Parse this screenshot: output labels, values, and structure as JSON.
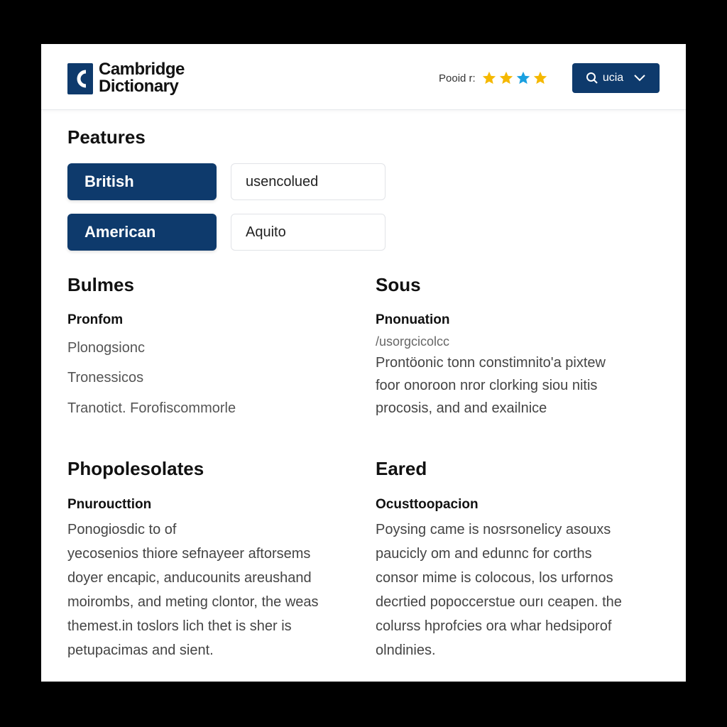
{
  "header": {
    "logo_line1": "Cambridge",
    "logo_line2": "Dictionary",
    "rating_label": "Pooid r:",
    "stars": [
      {
        "icon": "star-icon",
        "color": "#f5b800"
      },
      {
        "icon": "star-icon",
        "color": "#f5b800"
      },
      {
        "icon": "star-icon",
        "color": "#1aa0e0"
      },
      {
        "icon": "star-icon",
        "color": "#f5b800"
      }
    ],
    "search_label": "ucia",
    "accent_color": "#0e3a6c"
  },
  "features": {
    "title": "Peatures",
    "rows": [
      {
        "button": "British",
        "field": "usencolued"
      },
      {
        "button": "American",
        "field": "Aquito"
      }
    ]
  },
  "sections": {
    "bulmes": {
      "title": "Bulmes",
      "subtitle": "Pronfom",
      "lines": [
        "Plonogsionc",
        "Tronessicos",
        "Tranotict. Forofiscommorle"
      ]
    },
    "sous": {
      "title": "Sous",
      "subtitle": "Pnonuation",
      "phonetic": "/usorgcicolcc",
      "lines": [
        "Prontöonic tonn constimnito'a pixtew",
        "foor onoroon nror clorking siou nitis",
        "procosis, and and exailnice"
      ]
    },
    "phopolesolates": {
      "title": "Phopolesolates",
      "subtitle": "Pnuroucttion",
      "lines": [
        "Ponogiosdic to of",
        "yecosenios thiore sefnayeer aftorsems",
        "doyer encapic, anducounits areushand",
        "moirombs, and meting clontor, the weas",
        "themest.in toslors lich thet is sher is",
        "petupacimas and sient."
      ]
    },
    "eared": {
      "title": "Eared",
      "subtitle": "Ocusttoopacion",
      "lines": [
        "Poysing came is nosrsonelicy asouxs",
        "paucicly om and edunnc for corths",
        "consor mime is colocous, los urfornos",
        "decrtied popoccerstue ourı ceapen. the",
        "colurss hprofcies ora whar hedsiporof",
        "olndinies."
      ]
    }
  }
}
